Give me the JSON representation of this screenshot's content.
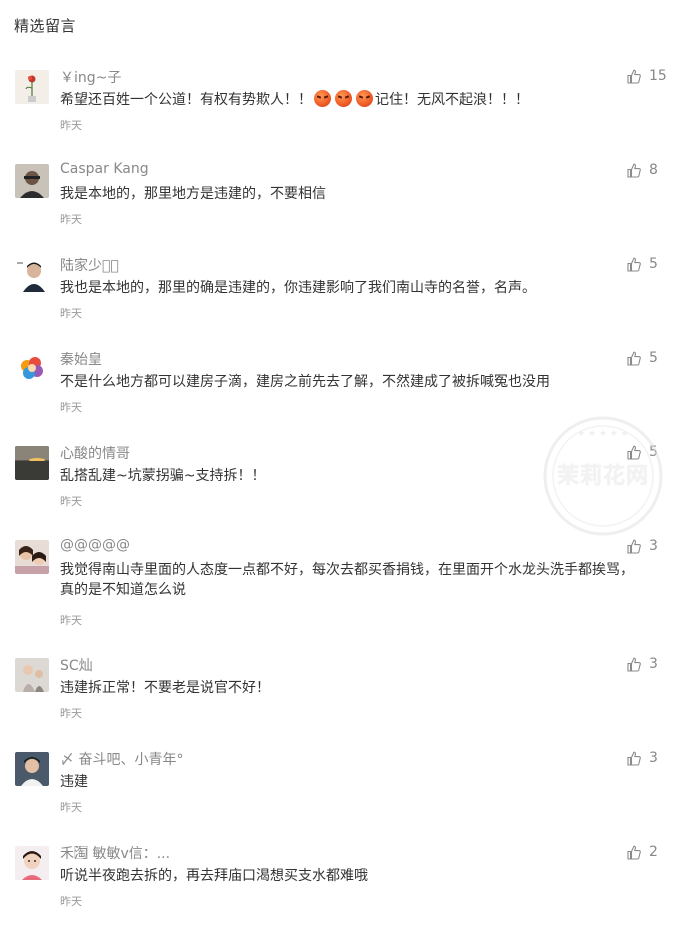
{
  "section": {
    "title": "精选留言"
  },
  "comments": [
    {
      "nickname": "￥ing~子",
      "content_before": "希望还百姓一个公道！有权有势欺人！！",
      "content_after": "记住！无风不起浪！！！",
      "emoji_icon": "angry-emoji-icon",
      "emoji_count": 3,
      "time": "昨天",
      "likes": "15"
    },
    {
      "nickname": "Caspar Kang",
      "content": "我是本地的，那里地方是违建的，不要相信",
      "time": "昨天",
      "likes": "8"
    },
    {
      "nickname": "陆家少爷⃠",
      "content": "我也是本地的，那里的确是违建的，你违建影响了我们南山寺的名誉，名声。",
      "time": "昨天",
      "likes": "5"
    },
    {
      "nickname": "秦始皇",
      "content": "不是什么地方都可以建房子滴，建房之前先去了解，不然建成了被拆喊冤也没用",
      "time": "昨天",
      "likes": "5"
    },
    {
      "nickname": "心酸的情哥",
      "content": "乱搭乱建~坑蒙拐骗~支持拆！！",
      "time": "昨天",
      "likes": "5"
    },
    {
      "nickname": "@@@@@",
      "content": "我觉得南山寺里面的人态度一点都不好，每次去都买香捐钱，在里面开个水龙头洗手都挨骂，真的是不知道怎么说",
      "time": "昨天",
      "likes": "3"
    },
    {
      "nickname": "SC灿",
      "content": "违建拆正常！不要老是说官不好！",
      "time": "昨天",
      "likes": "3"
    },
    {
      "nickname": "〆 奋斗吧、小青年°",
      "content": "违建",
      "time": "昨天",
      "likes": "3"
    },
    {
      "nickname": "禾淘⃞ 敏敏v信：...",
      "content": "听说半夜跑去拆的，再去拜庙口渴想买支水都难哦",
      "time": "昨天",
      "likes": "2"
    }
  ],
  "watermark": {
    "text": "茉莉花网",
    "icon": "site-watermark-seal"
  },
  "colors": {
    "nickname": "#888888",
    "content": "#333333",
    "time": "#999999",
    "like_icon": "#8a8a8a"
  }
}
